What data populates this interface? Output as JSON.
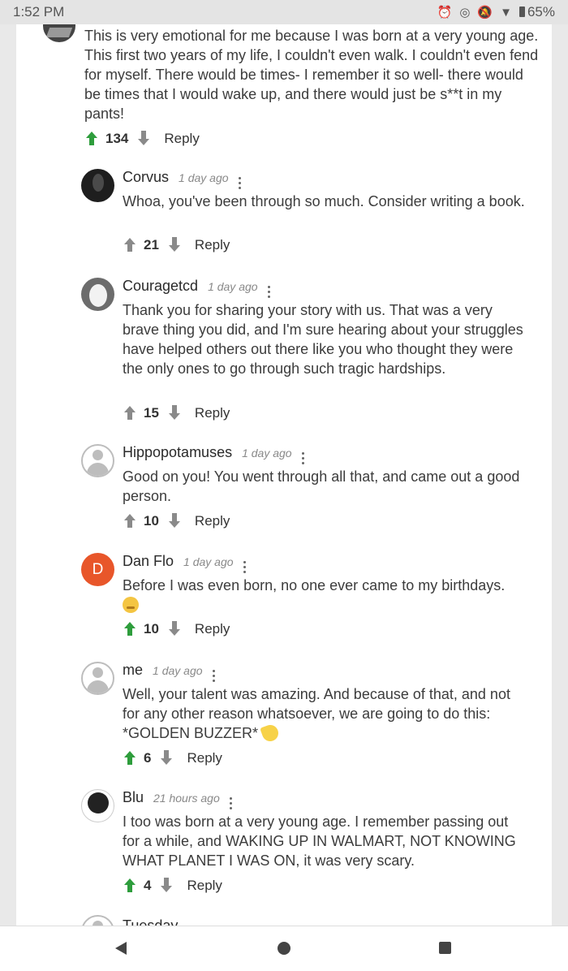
{
  "status_bar": {
    "time": "1:52 PM",
    "battery": "65%",
    "icons": [
      "alarm-icon",
      "data-saver-icon",
      "mute-icon",
      "wifi-icon",
      "battery-icon"
    ]
  },
  "top_comment": {
    "text": "This is very emotional for me because I was born at a very young age. This first two years of my life, I couldn't even walk. I couldn't even fend for myself. There would be times- I remember it so well- there would be times that I would wake up, and there would just be s**t in my pants!",
    "votes": "134",
    "reply_label": "Reply",
    "upvoted": true
  },
  "replies": [
    {
      "author": "Corvus",
      "time": "1 day ago",
      "text": "Whoa, you've been through so much. Consider writing a book.",
      "votes": "21",
      "reply_label": "Reply",
      "upvoted": false
    },
    {
      "author": "Couragetcd",
      "time": "1 day ago",
      "text": "Thank you for sharing your story with us. That was a very brave thing you did, and I'm sure hearing about your struggles have helped others out there like you who thought they were the only ones to go through such tragic hardships.",
      "votes": "15",
      "reply_label": "Reply",
      "upvoted": false
    },
    {
      "author": "Hippopotamuses",
      "time": "1 day ago",
      "text": "Good on you! You went through all that, and came out a good person.",
      "votes": "10",
      "reply_label": "Reply",
      "upvoted": false
    },
    {
      "author": "Dan Flo",
      "avatar_letter": "D",
      "time": "1 day ago",
      "text": "Before I was even born, no one ever came to my birthdays.",
      "emoji": "pensive-face-emoji",
      "votes": "10",
      "reply_label": "Reply",
      "upvoted": true
    },
    {
      "author": "me",
      "time": "1 day ago",
      "text": "Well, your talent was amazing. And because of that, and not for any other reason whatsoever, we are going to do this: *GOLDEN BUZZER*",
      "emoji": "party-popper-emoji",
      "votes": "6",
      "reply_label": "Reply",
      "upvoted": true
    },
    {
      "author": "Blu",
      "time": "21 hours ago",
      "text": "I too was born at a very young age. I remember passing out for a while, and WAKING UP IN WALMART, NOT KNOWING WHAT PLANET I WAS ON, it was very scary.",
      "votes": "4",
      "reply_label": "Reply",
      "upvoted": true
    }
  ],
  "cutoff_author": "Tuesday",
  "nav": [
    "back-icon",
    "home-icon",
    "recents-icon"
  ],
  "colors": {
    "upvote_green": "#2e9d3c",
    "avatar_orange": "#e8562a"
  }
}
